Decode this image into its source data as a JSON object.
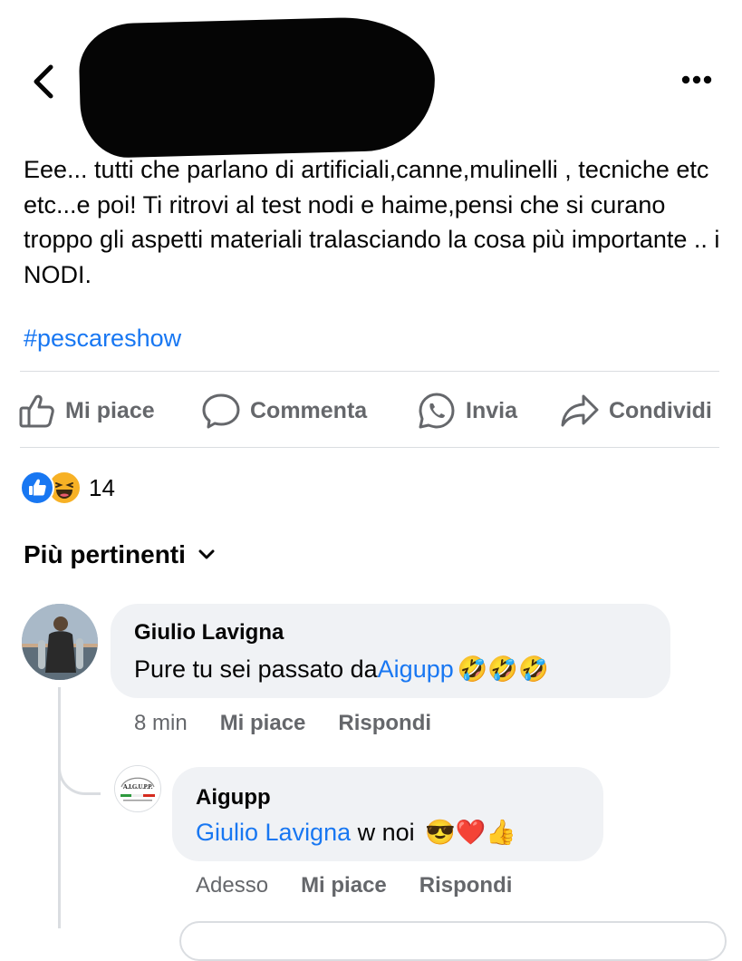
{
  "post": {
    "text": "Eee... tutti che parlano di artificiali,canne,mulinelli , tecniche etc etc...e poi! Ti ritrovi al test nodi e haime,pensi che si curano troppo gli aspetti materiali tralasciando la cosa più importante .. i NODI.",
    "hashtag": "#pescareshow"
  },
  "actions": {
    "like": "Mi piace",
    "comment": "Commenta",
    "send": "Invia",
    "share": "Condividi"
  },
  "reactions": {
    "count": "14",
    "types": [
      "like-icon",
      "haha-icon"
    ]
  },
  "sort_label": "Più pertinenti",
  "comments": [
    {
      "author": "Giulio Lavigna",
      "text": "Pure tu sei passato da ",
      "link": "Aigupp",
      "emoji": "🤣🤣🤣",
      "time": "8 min",
      "like": "Mi piace",
      "reply": "Rispondi",
      "replies": [
        {
          "author": "Aigupp",
          "avatar_text": "A.I.G.U.P.P.",
          "mention": "Giulio Lavigna",
          "text": " w noi ",
          "emoji": "😎❤️👍",
          "time": "Adesso",
          "like": "Mi piace",
          "reply": "Rispondi"
        }
      ]
    }
  ],
  "colors": {
    "link": "#1877f2",
    "muted": "#65676b",
    "bubble": "#f0f2f5",
    "divider": "#dadde1"
  }
}
